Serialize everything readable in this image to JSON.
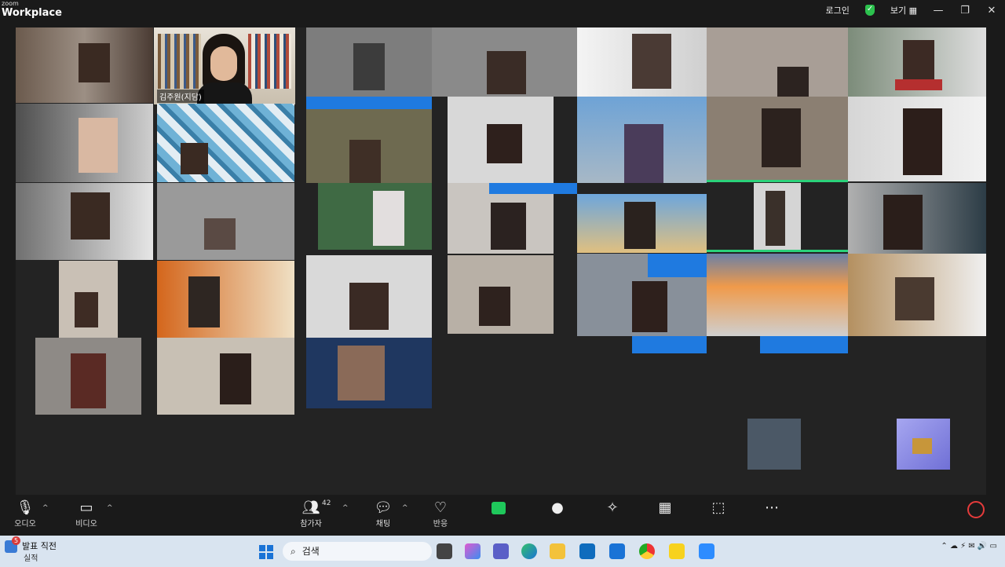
{
  "titlebar": {
    "brand_top": "zoom",
    "brand_bottom": "Workplace",
    "login": "로그인",
    "view": "보기",
    "view_icon": "grid-icon",
    "minimize": "—",
    "maximize": "❐",
    "close": "✕"
  },
  "gallery": {
    "host_name": "김주원(지담)"
  },
  "toolbar": {
    "audio_label": "오디오",
    "video_label": "비디오",
    "participants_label": "참가자",
    "participants_count": "42",
    "chat_label": "채팅",
    "react_label": "반응",
    "caret": "^"
  },
  "taskbar": {
    "weather_badge": "5",
    "weather_title": "발표 직전",
    "weather_sub": "실적",
    "search_placeholder": "검색"
  },
  "colors": {
    "accent_green": "#1fc85b",
    "active_speaker": "#2bd27a",
    "end_red": "#e63b3b",
    "highlight_blue": "#1f7ae0"
  }
}
